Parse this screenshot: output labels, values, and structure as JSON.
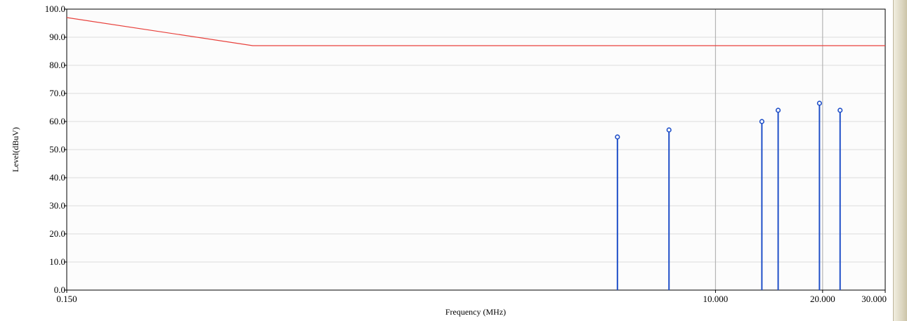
{
  "chart_data": {
    "type": "line",
    "xlabel": "Frequency (MHz)",
    "ylabel": "Level(dBuV)",
    "x_scale": "log",
    "xlim": [
      0.15,
      30.0
    ],
    "ylim": [
      0.0,
      100.0
    ],
    "grid": true,
    "y_ticks": [
      "0.0",
      "10.0",
      "20.0",
      "30.0",
      "40.0",
      "50.0",
      "60.0",
      "70.0",
      "80.0",
      "90.0",
      "100.0"
    ],
    "x_tick_labels": [
      {
        "value": 0.15,
        "label": "0.150"
      },
      {
        "value": 10.0,
        "label": "10.000"
      },
      {
        "value": 20.0,
        "label": "20.000"
      },
      {
        "value": 30.0,
        "label": "30.000"
      }
    ],
    "x_major_gridlines": [
      10.0,
      20.0
    ],
    "limit_line": {
      "color": "#e8413c",
      "points": [
        {
          "x": 0.15,
          "y": 97.0
        },
        {
          "x": 0.5,
          "y": 87.0
        },
        {
          "x": 30.0,
          "y": 87.0
        }
      ]
    },
    "peaks": {
      "color": "#1f4fc8",
      "points": [
        {
          "x": 5.3,
          "y": 54.5
        },
        {
          "x": 7.4,
          "y": 57.0
        },
        {
          "x": 13.5,
          "y": 60.0
        },
        {
          "x": 15.0,
          "y": 64.0
        },
        {
          "x": 19.6,
          "y": 66.5
        },
        {
          "x": 22.4,
          "y": 64.0
        }
      ]
    }
  }
}
